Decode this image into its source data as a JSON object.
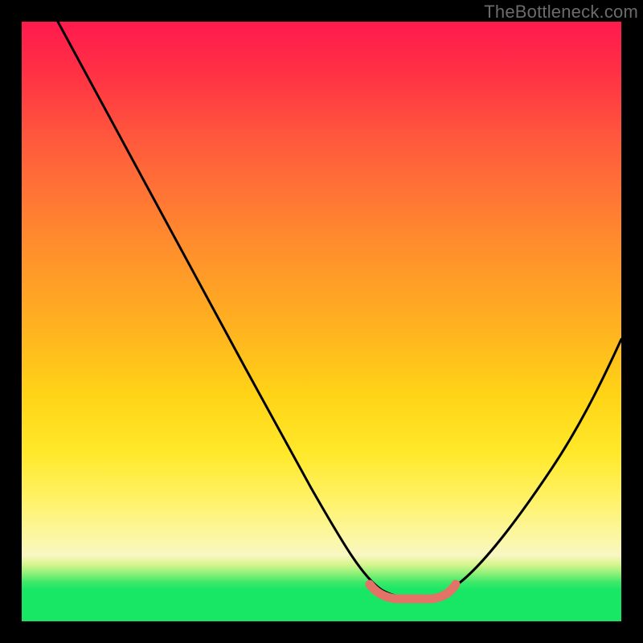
{
  "watermark": "TheBottleneck.com",
  "chart_data": {
    "type": "line",
    "title": "",
    "xlabel": "",
    "ylabel": "",
    "xlim": [
      0,
      100
    ],
    "ylim": [
      0,
      100
    ],
    "grid": false,
    "legend": false,
    "series": [
      {
        "name": "bottleneck-curve",
        "x": [
          6,
          10,
          15,
          20,
          25,
          30,
          35,
          40,
          45,
          50,
          55,
          58,
          60,
          62,
          64,
          66,
          68,
          70,
          72,
          75,
          80,
          85,
          90,
          95,
          100
        ],
        "values": [
          100,
          93,
          85,
          77,
          69,
          61,
          53,
          45,
          37,
          29,
          20,
          14,
          10,
          7,
          5,
          4,
          4,
          4,
          5,
          7,
          13,
          22,
          32,
          43,
          55
        ]
      },
      {
        "name": "optimal-range-marker",
        "x": [
          58,
          60,
          62,
          64,
          66,
          68,
          70,
          72
        ],
        "values": [
          6,
          5.2,
          4.6,
          4.3,
          4.2,
          4.3,
          4.7,
          5.4
        ]
      }
    ],
    "colors": {
      "curve": "#000000",
      "marker": "#e27366",
      "gradient_top": "#ff1a4e",
      "gradient_mid": "#ffd316",
      "gradient_bottom": "#18e765"
    }
  }
}
